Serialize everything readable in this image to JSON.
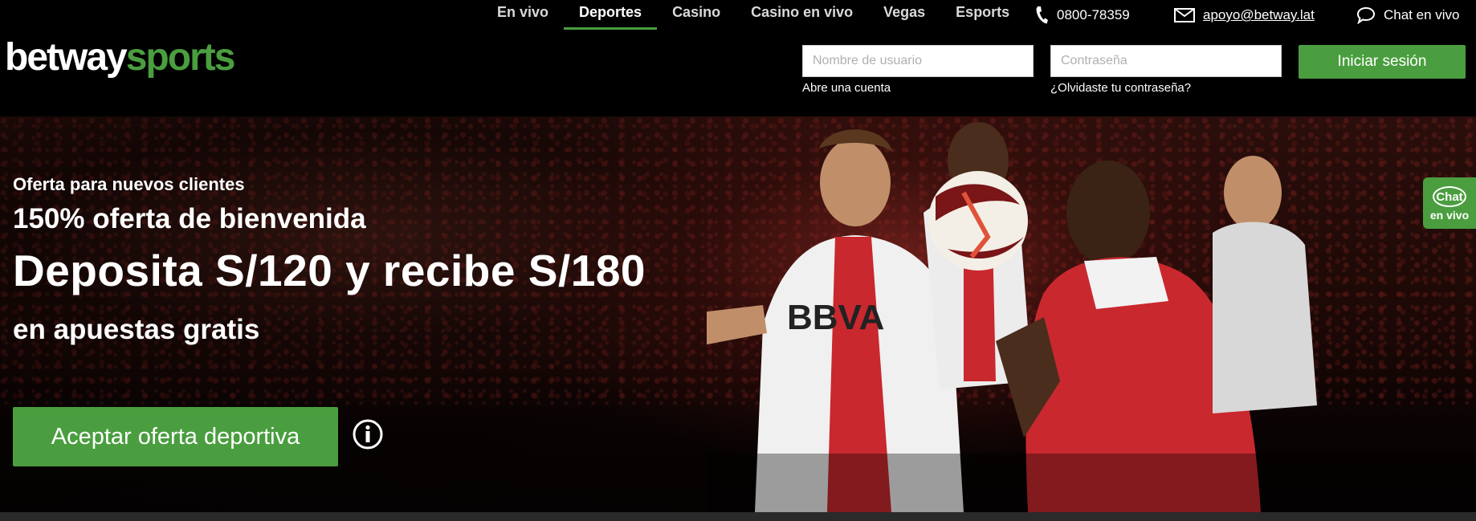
{
  "header": {
    "logo": {
      "part1": "betway",
      "part2": "sports"
    },
    "nav": [
      {
        "label": "En vivo",
        "active": false
      },
      {
        "label": "Deportes",
        "active": true
      },
      {
        "label": "Casino",
        "active": false
      },
      {
        "label": "Casino en vivo",
        "active": false
      },
      {
        "label": "Vegas",
        "active": false
      },
      {
        "label": "Esports",
        "active": false
      }
    ],
    "phone": "0800-78359",
    "email": "apoyo@betway.lat",
    "chat": "Chat en vivo",
    "login": {
      "username_placeholder": "Nombre de usuario",
      "password_placeholder": "Contraseña",
      "button": "Iniciar sesión",
      "open_account": "Abre una cuenta",
      "forgot_password": "¿Olvidaste tu contraseña?"
    }
  },
  "hero": {
    "kicker": "Oferta para nuevos clientes",
    "title": "150% oferta de bienvenida",
    "main": "Deposita S/120 y recibe S/180",
    "subtitle": "en apuestas gratis",
    "cta": "Aceptar oferta deportiva"
  },
  "chat_badge": {
    "top": "Chat",
    "bottom": "en vivo"
  },
  "colors": {
    "brand_green": "#4a9e3f",
    "background": "#000000"
  },
  "icons": [
    "phone-icon",
    "mail-icon",
    "chat-bubble-icon",
    "info-icon"
  ]
}
